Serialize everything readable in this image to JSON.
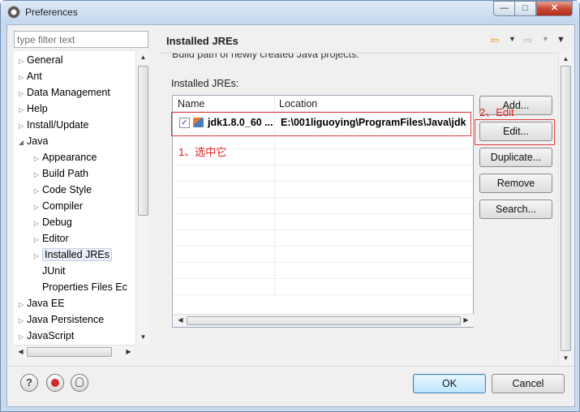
{
  "window": {
    "title": "Preferences",
    "controls": {
      "minimize": "—",
      "maximize": "□",
      "close": "✕"
    }
  },
  "sidebar": {
    "filter_placeholder": "type filter text",
    "tree": [
      {
        "label": "General",
        "expandable": true,
        "level": 0
      },
      {
        "label": "Ant",
        "expandable": true,
        "level": 0
      },
      {
        "label": "Data Management",
        "expandable": true,
        "level": 0
      },
      {
        "label": "Help",
        "expandable": true,
        "level": 0
      },
      {
        "label": "Install/Update",
        "expandable": true,
        "level": 0
      },
      {
        "label": "Java",
        "expandable": true,
        "expanded": true,
        "level": 0
      },
      {
        "label": "Appearance",
        "expandable": true,
        "level": 1
      },
      {
        "label": "Build Path",
        "expandable": true,
        "level": 1
      },
      {
        "label": "Code Style",
        "expandable": true,
        "level": 1
      },
      {
        "label": "Compiler",
        "expandable": true,
        "level": 1
      },
      {
        "label": "Debug",
        "expandable": true,
        "level": 1
      },
      {
        "label": "Editor",
        "expandable": true,
        "level": 1
      },
      {
        "label": "Installed JREs",
        "expandable": true,
        "level": 1,
        "selected": true
      },
      {
        "label": "JUnit",
        "expandable": false,
        "level": 1
      },
      {
        "label": "Properties Files Ec",
        "expandable": false,
        "level": 1
      },
      {
        "label": "Java EE",
        "expandable": true,
        "level": 0
      },
      {
        "label": "Java Persistence",
        "expandable": true,
        "level": 0
      },
      {
        "label": "JavaScript",
        "expandable": true,
        "level": 0
      }
    ]
  },
  "page": {
    "title": "Installed JREs",
    "cut_off_text": "Build path of newly created Java projects.",
    "jres_label": "Installed JREs:",
    "table": {
      "columns": [
        "Name",
        "Location"
      ],
      "rows": [
        {
          "checked": true,
          "name": "jdk1.8.0_60 ...",
          "location": "E:\\001liguoying\\ProgramFiles\\Java\\jdk"
        }
      ]
    },
    "buttons": {
      "add": "Add...",
      "edit": "Edit...",
      "duplicate": "Duplicate...",
      "remove": "Remove",
      "search": "Search..."
    },
    "annotations": {
      "step1": "1、选中它",
      "step2": "2、Edit"
    },
    "annotation_color": "#e02020"
  },
  "footer": {
    "ok": "OK",
    "cancel": "Cancel",
    "icons": [
      "help-icon",
      "stop-recording-icon",
      "tips-icon"
    ]
  },
  "colors": {
    "titlebar": "#c4d6ec",
    "close_button": "#c94a35",
    "ok_button": "#bde6fd"
  }
}
